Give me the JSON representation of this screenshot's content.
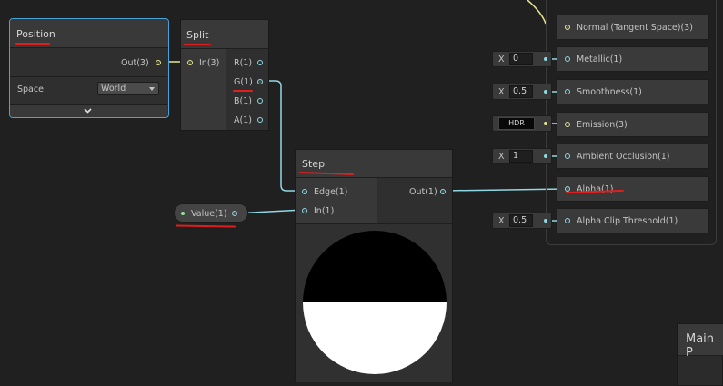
{
  "position_node": {
    "title": "Position",
    "out_label": "Out(3)",
    "space_label": "Space",
    "space_value": "World"
  },
  "split_node": {
    "title": "Split",
    "in_label": "In(3)",
    "outputs": [
      "R(1)",
      "G(1)",
      "B(1)",
      "A(1)"
    ]
  },
  "step_node": {
    "title": "Step",
    "inputs": [
      "Edge(1)",
      "In(1)"
    ],
    "out_label": "Out(1)"
  },
  "value_node": {
    "label": "Value(1)"
  },
  "master": {
    "top_entry": "Normal (Tangent Space)(3)",
    "entries": [
      {
        "label": "Metallic(1)",
        "x": "X",
        "value": "0"
      },
      {
        "label": "Smoothness(1)",
        "x": "X",
        "value": "0.5"
      },
      {
        "label": "Emission(3)",
        "hdr": "HDR"
      },
      {
        "label": "Ambient Occlusion(1)",
        "x": "X",
        "value": "1"
      },
      {
        "label": "Alpha(1)"
      },
      {
        "label": "Alpha Clip Threshold(1)",
        "x": "X",
        "value": "0.5"
      }
    ]
  },
  "main_preview": {
    "title": "Main P"
  },
  "colors": {
    "cyan_port": "#8fd8e4",
    "yellow_port": "#e4e48f",
    "annotation_red": "#e01e1e",
    "selection_blue": "#4aa3d8"
  }
}
